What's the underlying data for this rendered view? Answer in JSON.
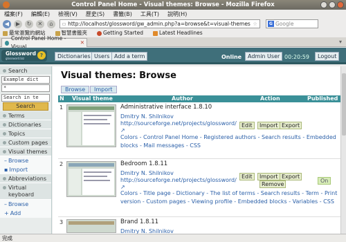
{
  "window": {
    "title": "Control Panel Home - Visual themes: Browse - Mozilla Firefox"
  },
  "menu": [
    "檔案(F)",
    "編輯(E)",
    "檢視(V)",
    "歷史(S)",
    "書籤(B)",
    "工具(T)",
    "說明(H)"
  ],
  "nav": {
    "url": "http://localhost/glossword/gw_admin.php?a=browse&t=visual-themes",
    "search_placeholder": "Google"
  },
  "bookmarks": [
    "最常瀏覽的網站",
    "智慧書籤夾",
    "Getting Started",
    "Latest Headlines"
  ],
  "tab": {
    "label": "Control Panel Home - Visual ..."
  },
  "header": {
    "logo": "Glossword",
    "logo_sub": "glossword.biz",
    "buttons": [
      "Dictionaries",
      "Users",
      "Add a term"
    ],
    "online_label": "Online",
    "user_label": "Admin User",
    "time": "00:20:59",
    "logout": "Logout"
  },
  "sidebar": {
    "search_heading": "Search",
    "dict_select": "Example dict",
    "query": "*",
    "scope_select": "Search in te",
    "search_button": "Search",
    "items": [
      "Terms",
      "Dictionaries",
      "Topics",
      "Custom pages",
      "Visual themes"
    ],
    "visual_sub": [
      "Browse",
      "Import"
    ],
    "items2": [
      "Abbreviations",
      "Virtual keyboard"
    ],
    "vk_sub": [
      "Browse",
      "Add"
    ]
  },
  "main": {
    "title": "Visual themes: Browse",
    "buttons": [
      "Browse",
      "Import"
    ],
    "columns": [
      "N",
      "Visual theme",
      "Author",
      "Action",
      "Published"
    ],
    "rows": [
      {
        "num": "1",
        "title": "Administrative interface 1.8.10",
        "author": "Dmitry N. Shilnikov",
        "author_url": "http://sourceforge.net/projects/glossword/",
        "links": "Colors - Control Panel Home - Registered authors - Search results - Embedded blocks - Mail messages - CSS",
        "actions": [
          "Edit",
          "Import",
          "Export"
        ],
        "published": ""
      },
      {
        "num": "2",
        "title": "Bedroom 1.8.11",
        "author": "Dmitry N. Shilnikov",
        "author_url": "http://sourceforge.net/projects/glossword/",
        "links": "Colors - Title page - Dictionary - The list of terms - Search results - Term - Print version - Custom pages - Viewing profile - Embedded blocks - Variables - CSS",
        "actions": [
          "Edit",
          "Import",
          "Export",
          "Remove"
        ],
        "published": "On"
      },
      {
        "num": "3",
        "title": "Brand 1.8.11",
        "author": "Dmitry N. Shilnikov"
      }
    ]
  },
  "status": "完成"
}
